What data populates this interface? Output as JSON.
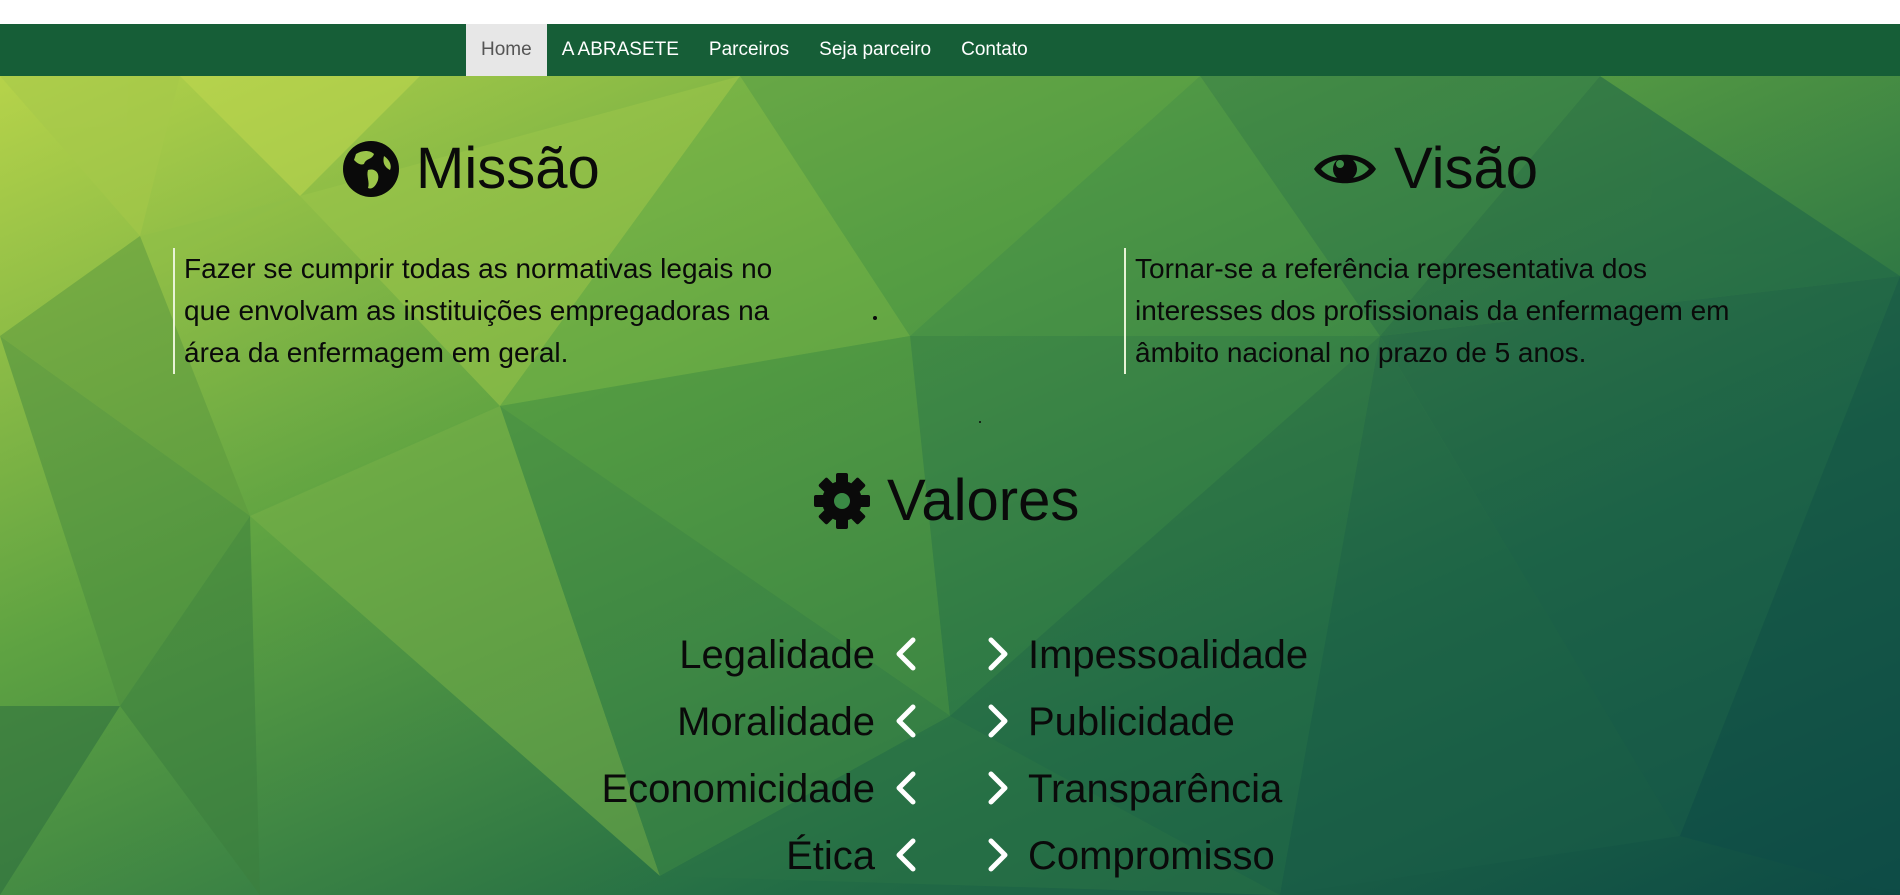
{
  "nav": {
    "items": [
      {
        "label": "Home",
        "active": true
      },
      {
        "label": "A ABRASETE",
        "active": false
      },
      {
        "label": "Parceiros",
        "active": false
      },
      {
        "label": "Seja parceiro",
        "active": false
      },
      {
        "label": "Contato",
        "active": false
      }
    ]
  },
  "colors": {
    "navbar": "#165e37",
    "active_tab": "#e7e7e7",
    "text": "#0a0a0a",
    "bg_light": "#b6d34a",
    "bg_dark": "#0d4a45"
  },
  "mission": {
    "icon": "globe-icon",
    "title": "Missão",
    "text": "Fazer se cumprir todas as normativas legais no que envolvam as instituições empregadoras na área da enfermagem em geral."
  },
  "vision": {
    "icon": "eye-icon",
    "title": "Visão",
    "text": "Tornar-se a referência representativa dos interesses dos profissionais da enfermagem em âmbito nacional no prazo de 5 anos."
  },
  "values": {
    "icon": "gear-icon",
    "title": "Valores",
    "rows": [
      {
        "left": "Legalidade",
        "right": "Impessoalidade"
      },
      {
        "left": "Moralidade",
        "right": "Publicidade"
      },
      {
        "left": "Economicidade",
        "right": "Transparência"
      },
      {
        "left": "Ética",
        "right": "Compromisso"
      }
    ]
  }
}
